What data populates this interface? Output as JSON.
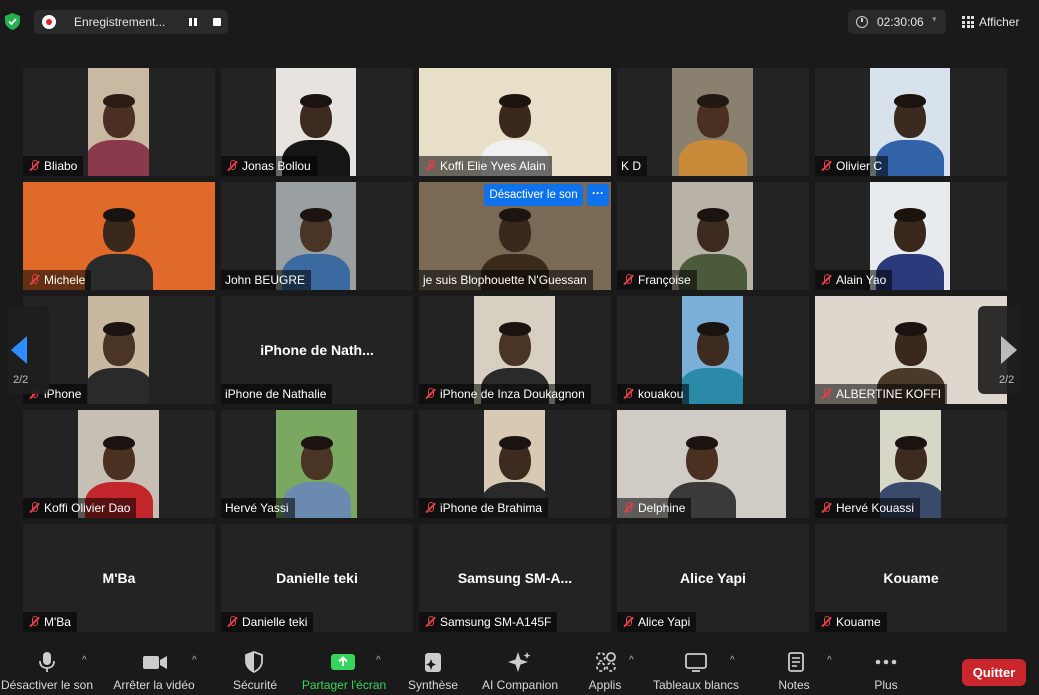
{
  "topbar": {
    "recording_label": "Enregistrement...",
    "timer": "02:30:06",
    "view_label": "Afficher"
  },
  "tiles": [
    {
      "name": "Bliabo",
      "muted": true,
      "video": true
    },
    {
      "name": "Jonas Bollou",
      "muted": true,
      "video": true
    },
    {
      "name": "Koffi Elie Yves Alain",
      "muted": true,
      "video": true
    },
    {
      "name": "K D",
      "muted": false,
      "video": true
    },
    {
      "name": "Olivier C",
      "muted": true,
      "video": true
    },
    {
      "name": "Michele",
      "muted": true,
      "video": true
    },
    {
      "name": "John BEUGRE",
      "muted": false,
      "video": true
    },
    {
      "name": "je suis Blophouette N'Guessan",
      "muted": false,
      "video": true
    },
    {
      "name": "Françoise",
      "muted": true,
      "video": true
    },
    {
      "name": "Alain Yao",
      "muted": true,
      "video": true
    },
    {
      "name": "iPhone",
      "muted": true,
      "video": true
    },
    {
      "name": "iPhone de Nathalie",
      "muted": false,
      "video": false,
      "center_label": "iPhone de Nath..."
    },
    {
      "name": "iPhone de Inza Doukagnon",
      "muted": true,
      "video": true
    },
    {
      "name": "kouakou",
      "muted": true,
      "video": true
    },
    {
      "name": "ALBERTINE KOFFI",
      "muted": true,
      "video": true
    },
    {
      "name": "Koffi Olivier Dao",
      "muted": true,
      "video": true
    },
    {
      "name": "Hervé Yassi",
      "muted": false,
      "video": true
    },
    {
      "name": "iPhone de Brahima",
      "muted": true,
      "video": true
    },
    {
      "name": "Delphine",
      "muted": true,
      "video": true
    },
    {
      "name": "Hervé Kouassi",
      "muted": true,
      "video": true
    },
    {
      "name": "M'Ba",
      "muted": true,
      "video": false,
      "center_label": "M'Ba"
    },
    {
      "name": "Danielle teki",
      "muted": true,
      "video": false,
      "center_label": "Danielle teki"
    },
    {
      "name": "Samsung SM-A145F",
      "muted": true,
      "video": false,
      "center_label": "Samsung  SM-A..."
    },
    {
      "name": "Alice Yapi",
      "muted": true,
      "video": false,
      "center_label": "Alice Yapi"
    },
    {
      "name": "Kouame",
      "muted": true,
      "video": false,
      "center_label": "Kouame"
    }
  ],
  "overlay": {
    "unmute_label": "Désactiver le son",
    "more_label": "···"
  },
  "pagination": {
    "left": "2/2",
    "right": "2/2"
  },
  "toolbar": {
    "mute": "Désactiver le son",
    "video": "Arrêter la vidéo",
    "security": "Sécurité",
    "share": "Partager l'écran",
    "summary": "Synthèse",
    "ai": "AI Companion",
    "apps": "Applis",
    "whiteboards": "Tableaux blancs",
    "notes": "Notes",
    "more": "Plus",
    "quit": "Quitter"
  },
  "colors": {
    "accent_blue": "#0e72ed",
    "share_green": "#35d45a",
    "quit_red": "#c9262e",
    "muted_red": "#e0404a"
  }
}
